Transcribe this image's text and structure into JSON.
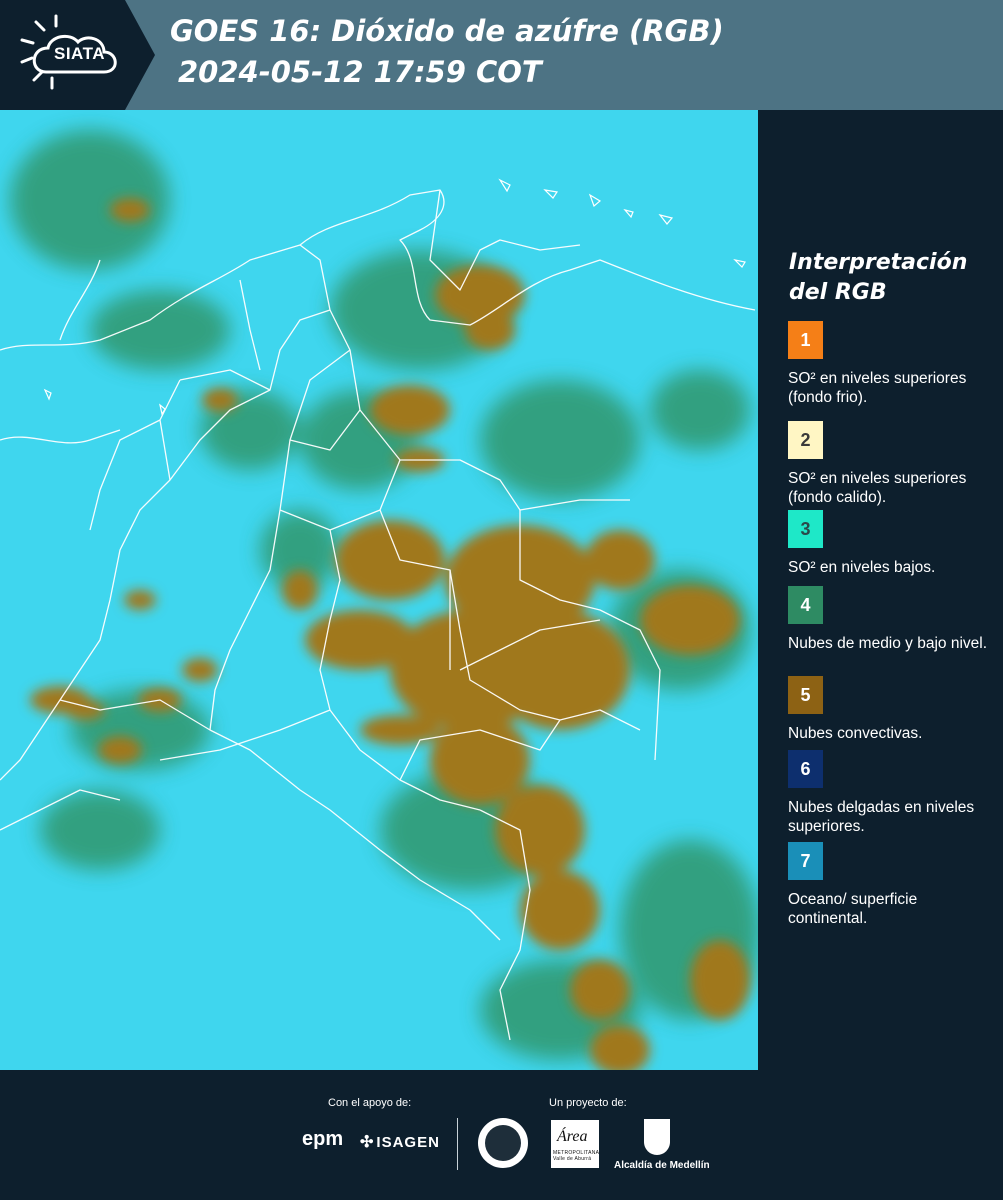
{
  "header": {
    "logo_text": "SIATA",
    "title": "GOES 16: Dióxido de azúfre (RGB)",
    "subtitle": " 2024-05-12 17:59 COT",
    "header_color": "#4d7384",
    "logo_bg_color": "#0d1f2d"
  },
  "map": {
    "background_color": "#3fd6ee",
    "convective_color": "#a0781e",
    "midlow_cloud_color": "#2f8f5c",
    "border_color": "#ffffff"
  },
  "legend": {
    "title": "Interpretación del RGB",
    "items": [
      {
        "number": "1",
        "color": "#f57f17",
        "text_color": "#ffffff",
        "label": "SO² en niveles superiores (fondo frio)."
      },
      {
        "number": "2",
        "color": "#fff6c4",
        "text_color": "#3a3a3a",
        "label": "SO² en niveles superiores (fondo calido)."
      },
      {
        "number": "3",
        "color": "#1ee8c8",
        "text_color": "#2a4a4a",
        "label": "SO² en niveles bajos."
      },
      {
        "number": "4",
        "color": "#2e8b63",
        "text_color": "#ffffff",
        "label": "Nubes de medio y bajo nivel."
      },
      {
        "number": "5",
        "color": "#8d6214",
        "text_color": "#ffffff",
        "label": "Nubes convectivas."
      },
      {
        "number": "6",
        "color": "#0d2f6e",
        "text_color": "#ffffff",
        "label": "Nubes delgadas en niveles superiores."
      },
      {
        "number": "7",
        "color": "#1a8fb8",
        "text_color": "#ffffff",
        "label": "Oceano/ superficie continental."
      }
    ]
  },
  "footer": {
    "support_label": "Con el apoyo de:",
    "project_label": "Un proyecto de:",
    "sponsor_1": "epm",
    "sponsor_2": "ISAGEN",
    "partner_area": "Área",
    "partner_area_sub": "METROPOLITANA Valle de Aburrá",
    "partner_alcaldia": "Alcaldía de Medellín"
  }
}
